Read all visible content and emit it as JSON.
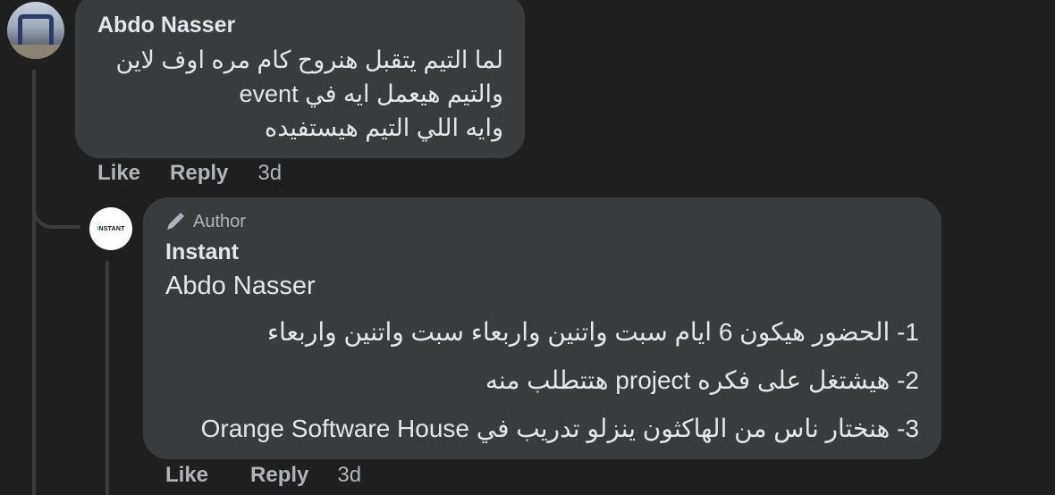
{
  "comment": {
    "author": "Abdo Nasser",
    "lines": [
      "لما التيم يتقبل هنروح كام مره اوف لاين",
      "والتيم هيعمل ايه في event",
      "وايه اللي التيم هيستفيده"
    ],
    "actions": {
      "like": "Like",
      "reply": "Reply",
      "time": "3d"
    }
  },
  "reply": {
    "badge": "Author",
    "badge_icon": "pencil-icon",
    "author": "Instant",
    "avatar_text": "INSTANT",
    "mention": "Abdo Nasser",
    "lines": [
      "1- الحضور هيكون 6 ايام سبت واتنين واربعاء سبت واتنين واربعاء",
      "2- هيشتغل على فكره project هتتطلب منه",
      "3- هنختار ناس من الهاكثون ينزلو تدريب في Orange Software House"
    ],
    "actions": {
      "like": "Like",
      "reply": "Reply",
      "time": "3d"
    }
  },
  "colors": {
    "background": "#1f1f20",
    "bubble": "#3a3b3c",
    "text": "#e4e6eb",
    "secondary": "#b0b3b8",
    "brand_accent": "#2aa7d8"
  }
}
